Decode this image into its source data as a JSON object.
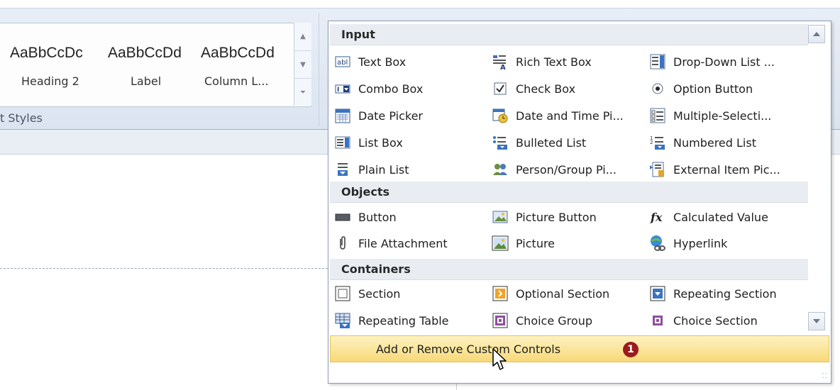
{
  "ribbon": {
    "gallery_samples": [
      "AaBbCcDc",
      "AaBbCcDd",
      "AaBbCcDd"
    ],
    "gallery_styles": [
      "Heading 2",
      "Label",
      "Column L..."
    ],
    "group_label": "t Styles"
  },
  "controls_menu": {
    "sections": {
      "input": "Input",
      "objects": "Objects",
      "containers": "Containers"
    },
    "input_items": [
      {
        "label": "Text Box",
        "icon": "text-box-icon"
      },
      {
        "label": "Rich Text Box",
        "icon": "rich-text-box-icon"
      },
      {
        "label": "Drop-Down List ...",
        "icon": "drop-down-list-icon"
      },
      {
        "label": "Combo Box",
        "icon": "combo-box-icon"
      },
      {
        "label": "Check Box",
        "icon": "check-box-icon"
      },
      {
        "label": "Option Button",
        "icon": "option-button-icon"
      },
      {
        "label": "Date Picker",
        "icon": "date-picker-icon"
      },
      {
        "label": "Date and Time Pi...",
        "icon": "date-time-picker-icon"
      },
      {
        "label": "Multiple-Selecti...",
        "icon": "multiple-selection-list-icon"
      },
      {
        "label": "List Box",
        "icon": "list-box-icon"
      },
      {
        "label": "Bulleted List",
        "icon": "bulleted-list-icon"
      },
      {
        "label": "Numbered List",
        "icon": "numbered-list-icon"
      },
      {
        "label": "Plain List",
        "icon": "plain-list-icon"
      },
      {
        "label": "Person/Group Pi...",
        "icon": "person-group-picker-icon"
      },
      {
        "label": "External Item Pic...",
        "icon": "external-item-picker-icon"
      }
    ],
    "object_items": [
      {
        "label": "Button",
        "icon": "button-icon"
      },
      {
        "label": "Picture Button",
        "icon": "picture-button-icon"
      },
      {
        "label": "Calculated Value",
        "icon": "calculated-value-icon"
      },
      {
        "label": "File Attachment",
        "icon": "file-attachment-icon"
      },
      {
        "label": "Picture",
        "icon": "picture-icon"
      },
      {
        "label": "Hyperlink",
        "icon": "hyperlink-icon"
      }
    ],
    "container_items": [
      {
        "label": "Section",
        "icon": "section-icon"
      },
      {
        "label": "Optional Section",
        "icon": "optional-section-icon"
      },
      {
        "label": "Repeating Section",
        "icon": "repeating-section-icon"
      },
      {
        "label": "Repeating Table",
        "icon": "repeating-table-icon"
      },
      {
        "label": "Choice Group",
        "icon": "choice-group-icon"
      },
      {
        "label": "Choice Section",
        "icon": "choice-section-icon"
      }
    ],
    "footer_action": "Add or Remove Custom Controls",
    "callout_number": "1"
  },
  "colors": {
    "highlight": "#f8d978",
    "callout": "#9b1b1e",
    "accent": "#3a73c2"
  }
}
